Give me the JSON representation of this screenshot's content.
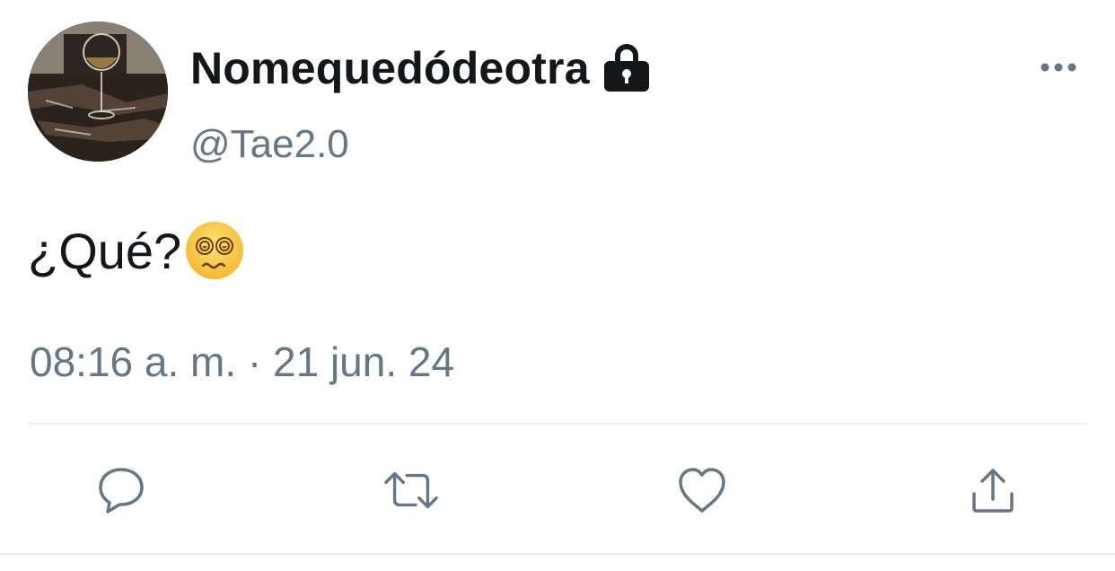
{
  "tweet": {
    "display_name": "Nomequedódeotra",
    "handle": "@Tae2.0",
    "text": "¿Qué?",
    "text_emoji": "dizzy-face-spiral-eyes",
    "timestamp": "08:16 a. m. · 21 jun. 24",
    "account_locked": true
  },
  "actions": [
    {
      "name": "reply",
      "icon": "reply-icon"
    },
    {
      "name": "retweet",
      "icon": "retweet-icon"
    },
    {
      "name": "like",
      "icon": "heart-icon"
    },
    {
      "name": "share",
      "icon": "share-icon"
    }
  ],
  "colors": {
    "text_primary": "#14171a",
    "text_secondary": "#657786",
    "divider": "#e6ecf0"
  }
}
